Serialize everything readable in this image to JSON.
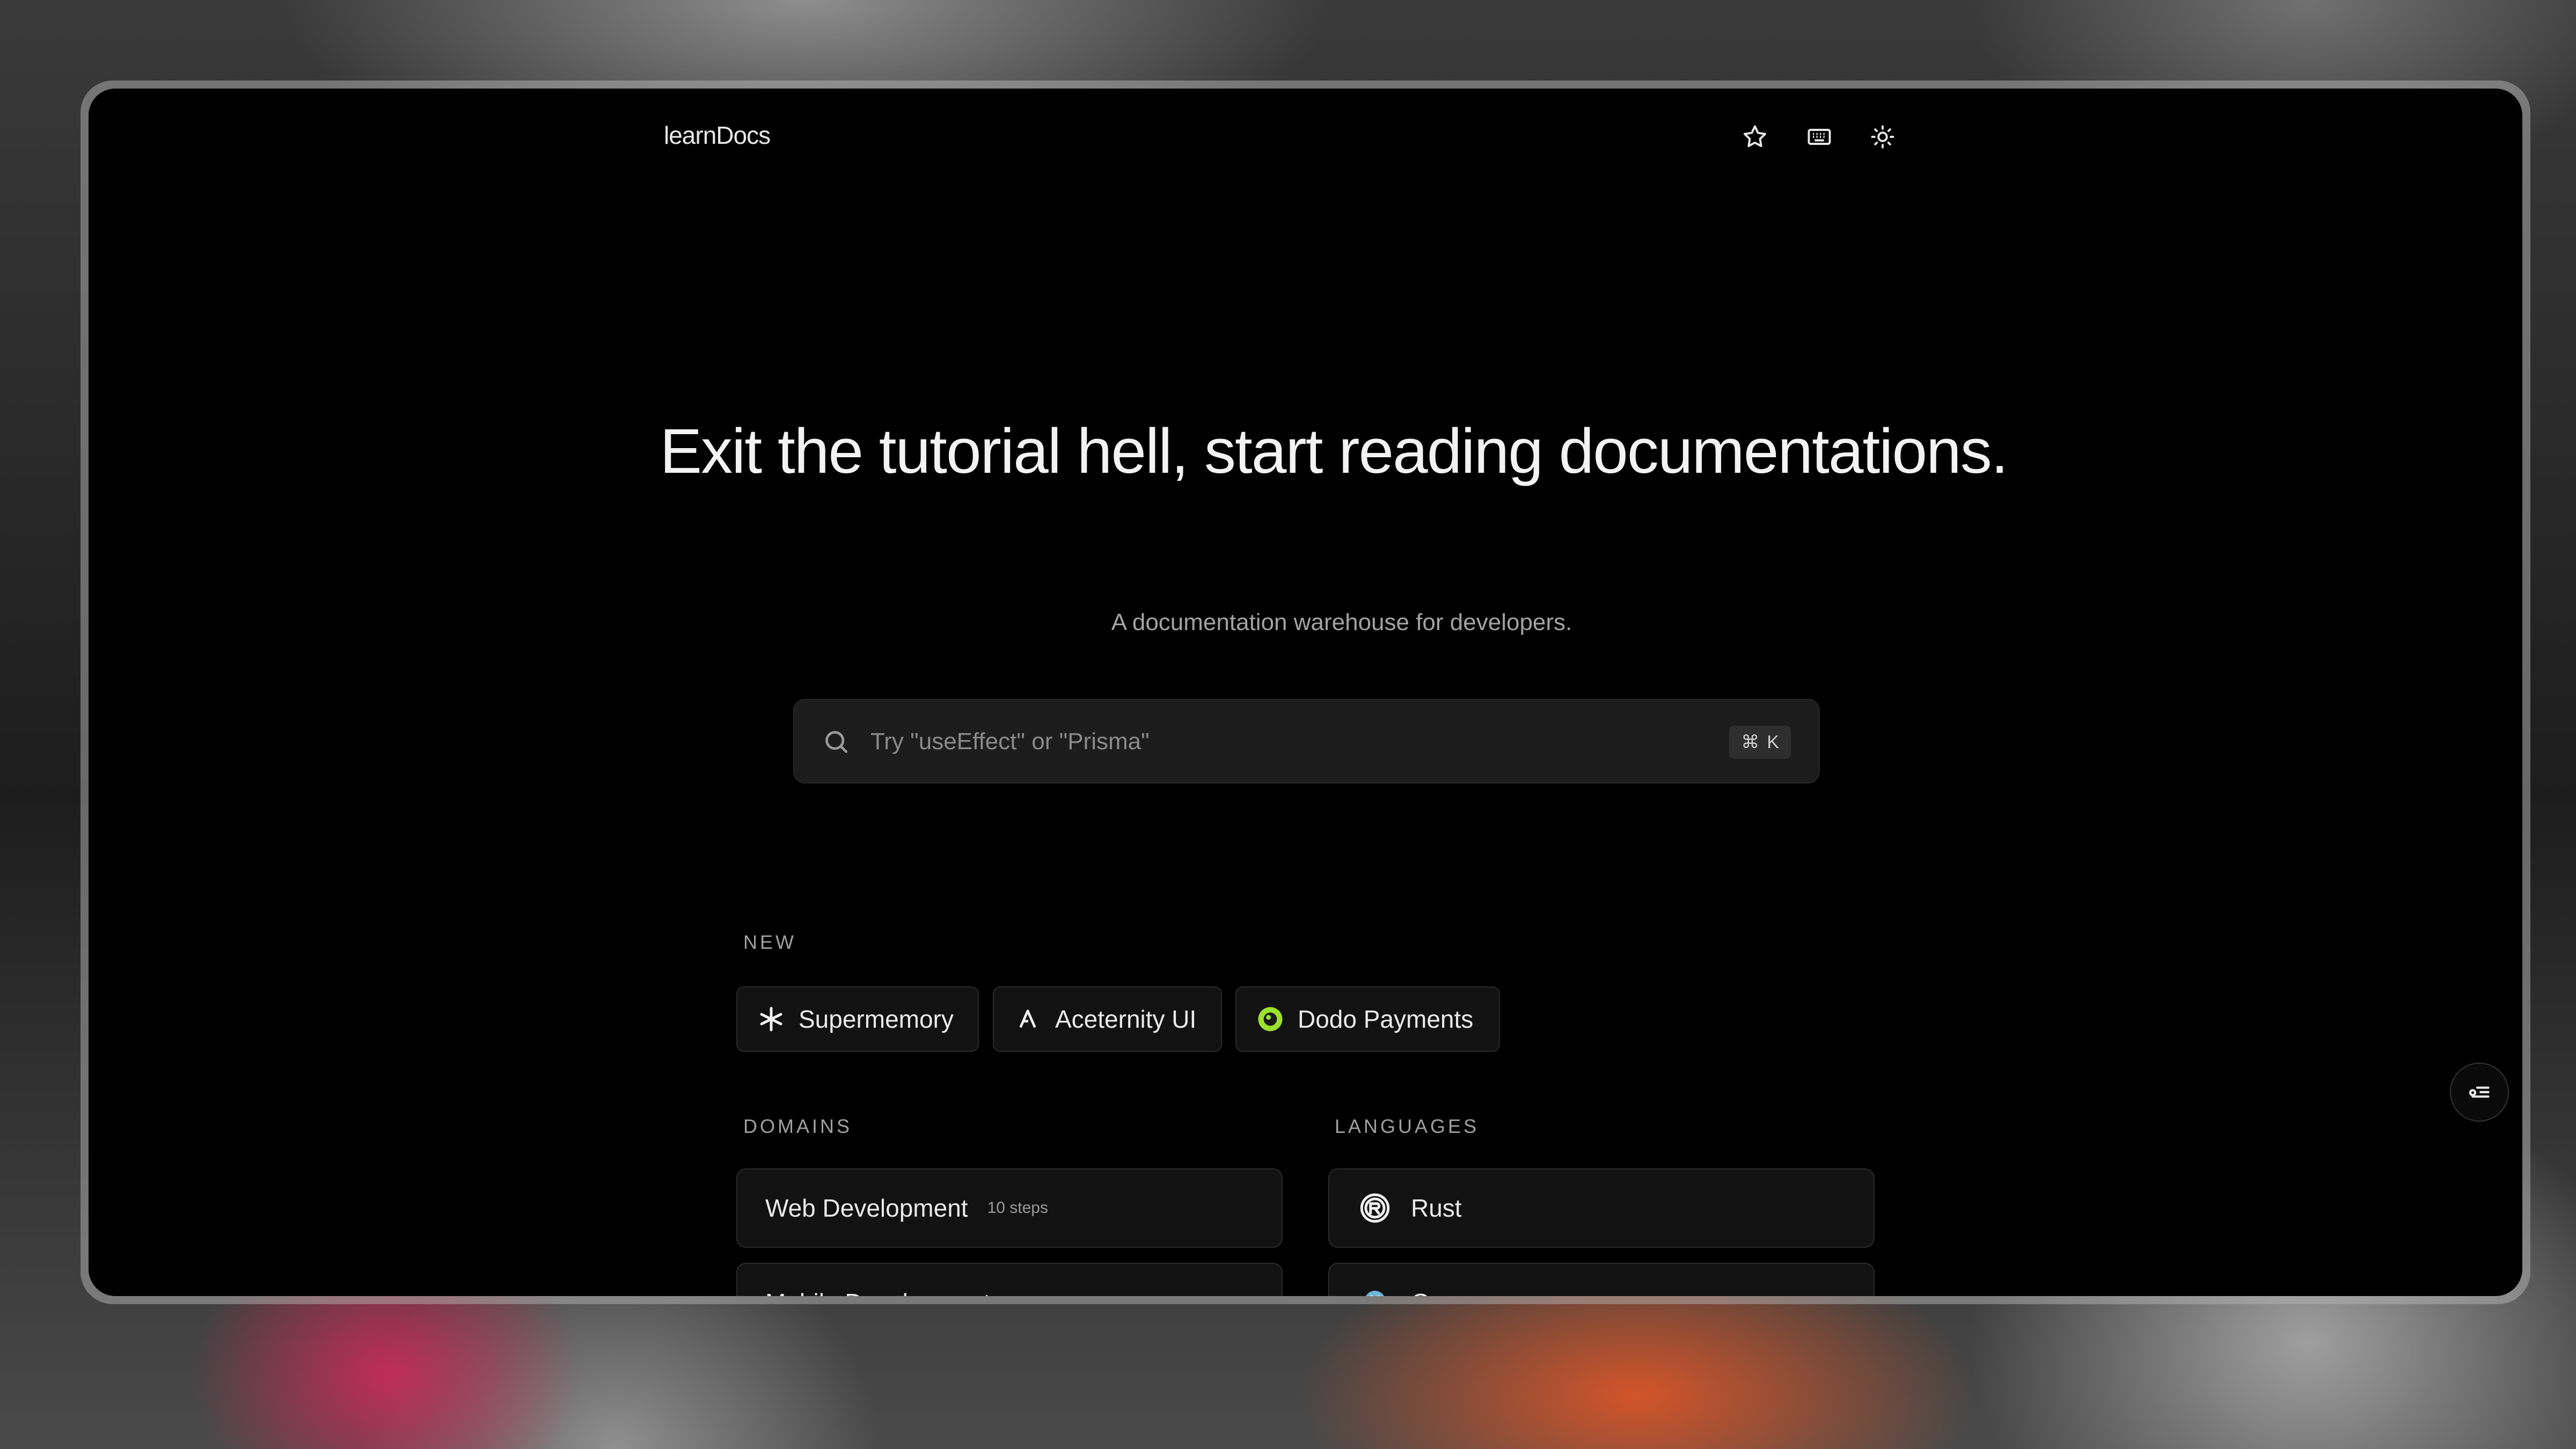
{
  "header": {
    "brand": "learnDocs",
    "icons": [
      "star-icon",
      "keyboard-icon",
      "sun-icon"
    ]
  },
  "hero": {
    "title": "Exit the tutorial hell, start reading documentations.",
    "subtitle": "A documentation warehouse for developers."
  },
  "search": {
    "placeholder": "Try \"useEffect\" or \"Prisma\"",
    "value": "",
    "shortcut_symbol": "⌘",
    "shortcut_key": "K"
  },
  "new_section": {
    "label": "NEW",
    "items": [
      {
        "label": "Supermemory",
        "icon": "asterisk-icon"
      },
      {
        "label": "Aceternity UI",
        "icon": "aceternity-logo-icon"
      },
      {
        "label": "Dodo Payments",
        "icon": "dodo-logo-icon",
        "icon_color": "#9be22d"
      }
    ]
  },
  "domains": {
    "label": "DOMAINS",
    "items": [
      {
        "label": "Web Development",
        "badge": "10 steps"
      },
      {
        "label": "Mobile Development",
        "badge": ""
      }
    ]
  },
  "languages": {
    "label": "LANGUAGES",
    "items": [
      {
        "label": "Rust",
        "icon": "rust-logo-icon"
      },
      {
        "label": "Go",
        "icon": "go-logo-icon"
      }
    ]
  },
  "colors": {
    "window_bg": "#000000",
    "surface": "#121212",
    "search_bg": "#1c1c1c",
    "accent_dodo": "#9be22d",
    "accent_pink": "#d6285a",
    "accent_orange": "#e25626"
  }
}
